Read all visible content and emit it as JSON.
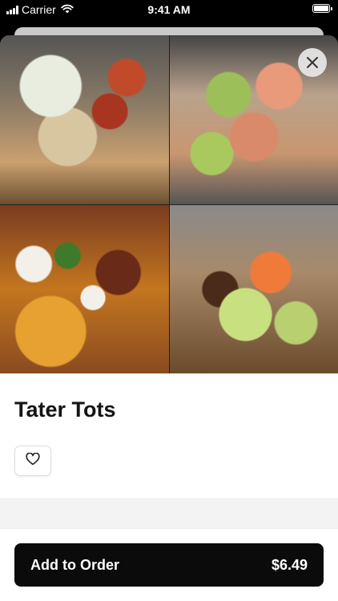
{
  "status_bar": {
    "carrier": "Carrier",
    "time": "9:41 AM"
  },
  "item": {
    "title": "Tater Tots",
    "photos": [
      "loaded tots with ranch and hot sauce",
      "loaded tots with lettuce and salmon",
      "loaded tots with bacon, sour cream and cilantro",
      "loaded tots with lettuce and orange sauce"
    ]
  },
  "actions": {
    "add_to_order_label": "Add to Order",
    "price": "$6.49"
  },
  "icons": {
    "close": "close-icon",
    "favorite": "heart-icon",
    "wifi": "wifi-icon",
    "signal": "signal-icon",
    "battery": "battery-icon"
  }
}
